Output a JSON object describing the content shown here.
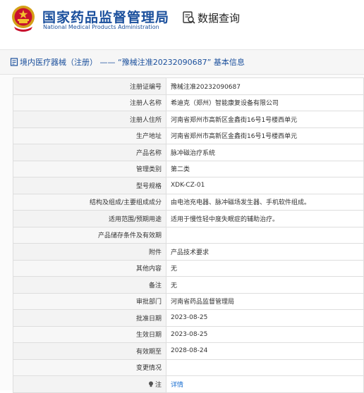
{
  "header": {
    "agency_name_cn": "国家药品监督管理局",
    "agency_name_en": "National Medical Products Administration",
    "query_label": "数据查询",
    "emblem_icon": "national-emblem-icon",
    "query_icon": "search-data-icon"
  },
  "colors": {
    "brand": "#1a4f9c",
    "link": "#1a6fd1",
    "label_bg": "#f3f3f3",
    "border": "#dedede"
  },
  "panel": {
    "title": "境内医疗器械（注册） —— “豫械注准20232090687” 基本信息",
    "title_icon": "document-icon"
  },
  "rows": [
    {
      "label": "注册证编号",
      "value": "豫械注准20232090687"
    },
    {
      "label": "注册人名称",
      "value": "希迪克（郑州）智能康复设备有限公司"
    },
    {
      "label": "注册人住所",
      "value": "河南省郑州市高新区金鑫街16号1号楼西单元"
    },
    {
      "label": "生产地址",
      "value": "河南省郑州市高新区金鑫街16号1号楼西单元"
    },
    {
      "label": "产品名称",
      "value": "脉冲磁治疗系统"
    },
    {
      "label": "管理类别",
      "value": "第二类"
    },
    {
      "label": "型号规格",
      "value": "XDK-CZ-01"
    },
    {
      "label": "结构及组成/主要组成成分",
      "value": "由电池充电器、脉冲磁场发生器、手机软件组成。"
    },
    {
      "label": "适用范围/预期用途",
      "value": "适用于慢性轻中度失眠症的辅助治疗。"
    },
    {
      "label": "产品储存条件及有效期",
      "value": ""
    },
    {
      "label": "附件",
      "value": "产品技术要求"
    },
    {
      "label": "其他内容",
      "value": "无"
    },
    {
      "label": "备注",
      "value": "无"
    },
    {
      "label": "审批部门",
      "value": "河南省药品监督管理局"
    },
    {
      "label": "批准日期",
      "value": "2023-08-25"
    },
    {
      "label": "生效日期",
      "value": "2023-08-25"
    },
    {
      "label": "有效期至",
      "value": "2028-08-24"
    },
    {
      "label": "变更情况",
      "value": ""
    }
  ],
  "note_row": {
    "label": "注",
    "link_text": "详情",
    "icon": "lightbulb-icon"
  }
}
